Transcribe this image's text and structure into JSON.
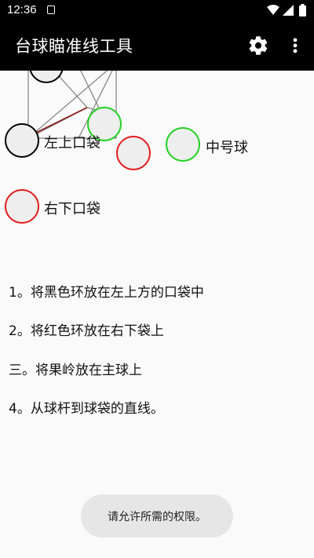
{
  "status_bar": {
    "time": "12:36",
    "icons": [
      "notification-a-icon",
      "wifi-icon",
      "signal-icon",
      "battery-icon"
    ]
  },
  "app_bar": {
    "title": "台球瞄准线工具",
    "actions": [
      "settings-gear-icon",
      "overflow-menu-icon"
    ]
  },
  "diagram": {
    "labels": {
      "top_left_pocket": "左上口袋",
      "medium_ball": "中号球",
      "bottom_right_pocket": "右下口袋"
    },
    "colors": {
      "black_ring": "#000000",
      "red_ring": "#e31b1b",
      "green_ring": "#1fd11f",
      "ball_fill": "#eeeeee",
      "guide_line": "#888888",
      "aim_line": "#8b1a1a"
    }
  },
  "instructions": [
    "1。将黑色环放在左上方的口袋中",
    "2。将红色环放在右下袋上",
    "三。将果岭放在主球上",
    "4。从球杆到球袋的直线。"
  ],
  "toast": "请允许所需的权限。"
}
